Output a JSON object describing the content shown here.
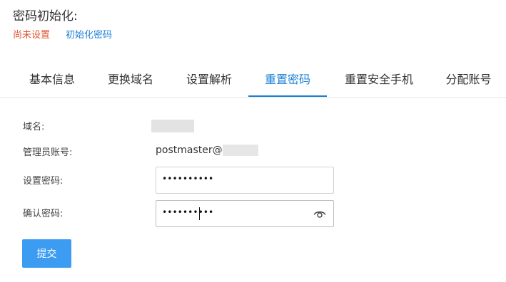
{
  "colors": {
    "accent": "#1b7fd8",
    "warning": "#e0552f",
    "button": "#3c9cf2"
  },
  "page": {
    "title": "密码初始化:"
  },
  "status": {
    "not_set": "尚未设置",
    "init_link": "初始化密码"
  },
  "tabs": [
    {
      "label": "基本信息",
      "active": false
    },
    {
      "label": "更换域名",
      "active": false
    },
    {
      "label": "设置解析",
      "active": false
    },
    {
      "label": "重置密码",
      "active": true
    },
    {
      "label": "重置安全手机",
      "active": false
    },
    {
      "label": "分配账号",
      "active": false
    }
  ],
  "form": {
    "domain_label": "域名:",
    "admin_label": "管理员账号:",
    "admin_value_prefix": "postmaster@",
    "password_label": "设置密码:",
    "password_value": "••••••••••",
    "confirm_label": "确认密码:",
    "confirm_value": "••••••••••",
    "reveal_icon": "eye-icon",
    "submit_label": "提交"
  }
}
